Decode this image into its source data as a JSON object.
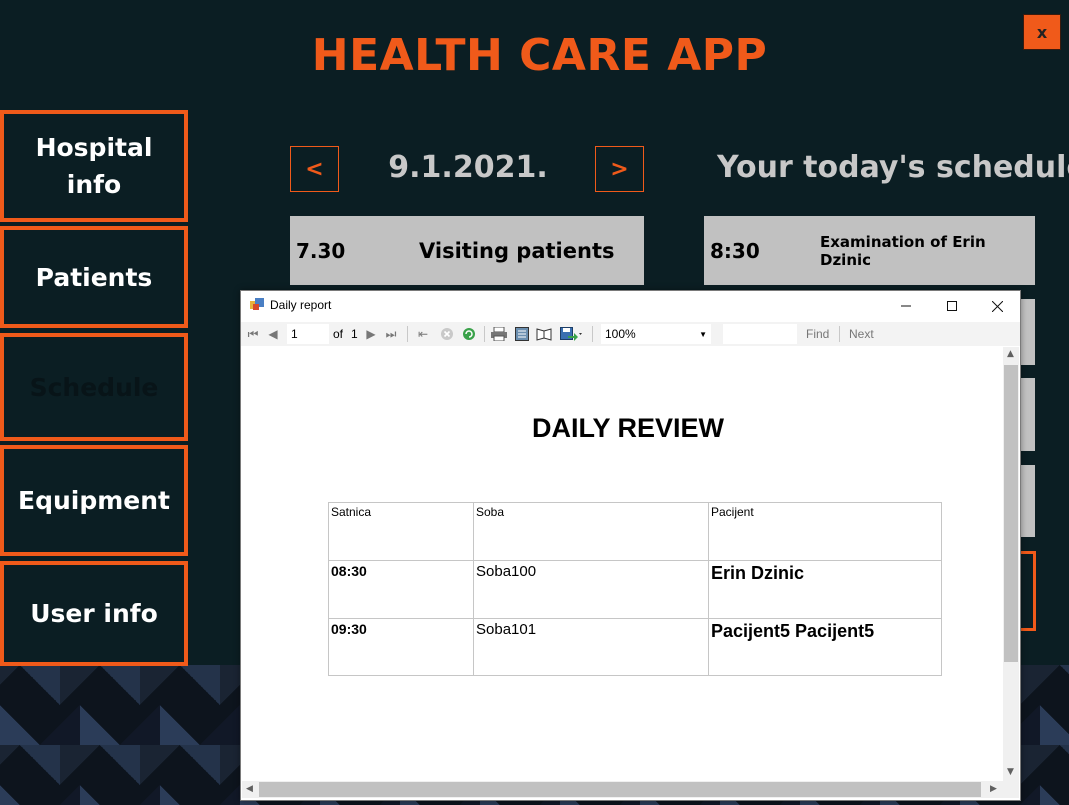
{
  "app": {
    "title": "HEALTH CARE APP",
    "close_label": "x"
  },
  "sidebar": {
    "items": [
      {
        "label": "Hospital info"
      },
      {
        "label": "Patients"
      },
      {
        "label": "Schedule"
      },
      {
        "label": "Equipment"
      },
      {
        "label": "User info"
      }
    ]
  },
  "schedule": {
    "prev_label": "<",
    "next_label": ">",
    "date": "9.1.2021.",
    "heading": "Your today's schedule",
    "left_slot": {
      "time": "7.30",
      "desc": "Visiting patients"
    },
    "right_slot": {
      "time": "8:30",
      "desc": "Examination of Erin Dzinic"
    }
  },
  "dialog": {
    "title": "Daily report",
    "toolbar": {
      "page": "1",
      "of_label": "of",
      "total_pages": "1",
      "zoom": "100%",
      "find_label": "Find",
      "next_label": "Next"
    },
    "report": {
      "title": "DAILY REVIEW",
      "columns": [
        "Satnica",
        "Soba",
        "Pacijent"
      ],
      "rows": [
        {
          "time": "08:30",
          "room": "Soba100",
          "patient": "Erin Dzinic"
        },
        {
          "time": "09:30",
          "room": "Soba101",
          "patient": "Pacijent5 Pacijent5"
        }
      ]
    }
  },
  "colors": {
    "accent": "#f05a1a",
    "background": "#0b1e23",
    "slot": "#c1c1c1"
  }
}
